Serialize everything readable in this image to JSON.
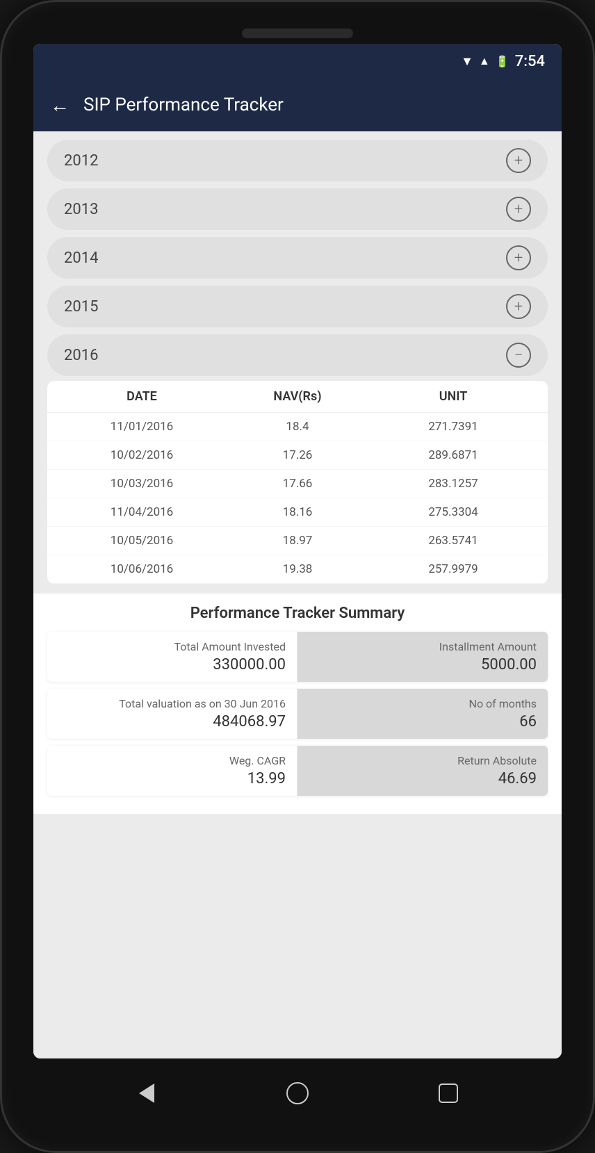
{
  "statusBar": {
    "time": "7:54"
  },
  "appBar": {
    "title": "SIP Performance Tracker",
    "backLabel": "←"
  },
  "yearRows": [
    {
      "year": "2012",
      "expanded": false
    },
    {
      "year": "2013",
      "expanded": false
    },
    {
      "year": "2014",
      "expanded": false
    },
    {
      "year": "2015",
      "expanded": false
    },
    {
      "year": "2016",
      "expanded": true
    }
  ],
  "table": {
    "headers": [
      "DATE",
      "NAV(Rs)",
      "UNIT"
    ],
    "rows": [
      {
        "date": "11/01/2016",
        "nav": "18.4",
        "unit": "271.7391"
      },
      {
        "date": "10/02/2016",
        "nav": "17.26",
        "unit": "289.6871"
      },
      {
        "date": "10/03/2016",
        "nav": "17.66",
        "unit": "283.1257"
      },
      {
        "date": "11/04/2016",
        "nav": "18.16",
        "unit": "275.3304"
      },
      {
        "date": "10/05/2016",
        "nav": "18.97",
        "unit": "263.5741"
      },
      {
        "date": "10/06/2016",
        "nav": "19.38",
        "unit": "257.9979"
      }
    ]
  },
  "summary": {
    "title": "Performance Tracker Summary",
    "cards": [
      {
        "leftLabel": "Total Amount Invested",
        "leftValue": "330000.00",
        "rightLabel": "Installment Amount",
        "rightValue": "5000.00"
      },
      {
        "leftLabel": "Total valuation as on 30 Jun 2016",
        "leftValue": "484068.97",
        "rightLabel": "No of months",
        "rightValue": "66"
      },
      {
        "leftLabel": "Weg. CAGR",
        "leftValue": "13.99",
        "rightLabel": "Return Absolute",
        "rightValue": "46.69"
      }
    ]
  }
}
